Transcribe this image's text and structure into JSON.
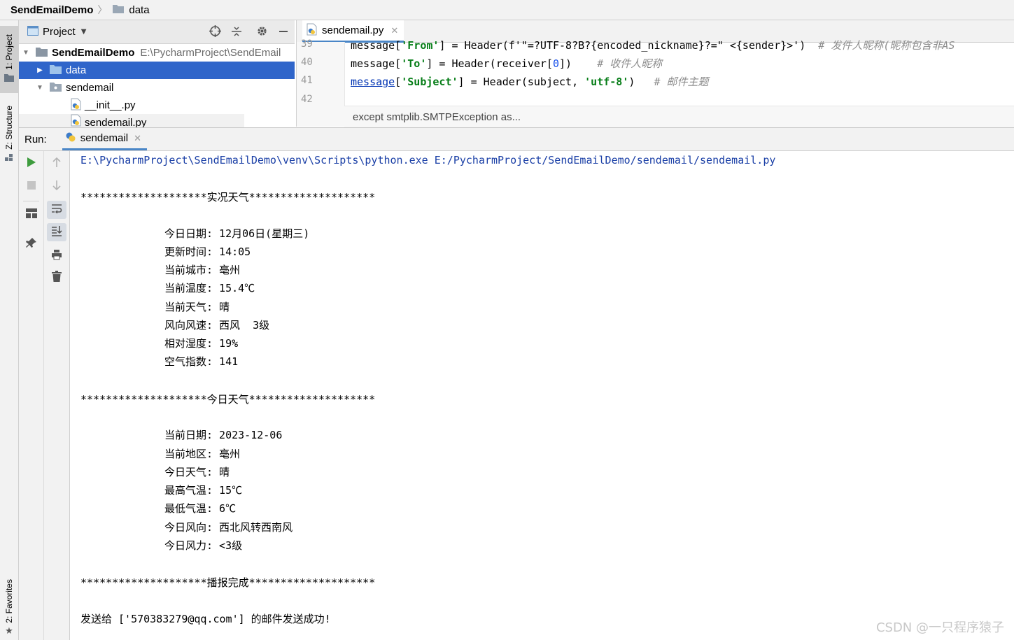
{
  "breadcrumb": {
    "project": "SendEmailDemo",
    "folder": "data"
  },
  "tool_strip": {
    "project_tab": "1: Project",
    "structure_tab": "Z: Structure",
    "favorites_tab": "2: Favorites"
  },
  "project_panel": {
    "title": "Project",
    "tree": [
      {
        "label": "SendEmailDemo",
        "path": "E:\\PycharmProject\\SendEmail"
      },
      {
        "label": "data"
      },
      {
        "label": "sendemail"
      },
      {
        "label": "__init__.py"
      },
      {
        "label": "sendemail.py"
      }
    ]
  },
  "editor": {
    "tab_label": "sendemail.py",
    "line_numbers": [
      "39",
      "40",
      "41",
      "42"
    ],
    "line39": {
      "a": "message[",
      "b": "'From'",
      "c": "] = Header(f'\"=?UTF-8?B?{encoded_nickname}?=\" <{sender}>')  ",
      "d": "# 发件人昵称(昵称包含非AS"
    },
    "line40": {
      "a": "message[",
      "b": "'To'",
      "c": "] = Header(receiver[",
      "n": "0",
      "e": "])    ",
      "d": "# 收件人昵称"
    },
    "line41": {
      "f": "message",
      "a": "[",
      "b": "'Subject'",
      "c": "] = Header(subject, ",
      "s": "'utf-8'",
      "e": ")   ",
      "d": "# 邮件主题"
    },
    "context_hint": "except smtplib.SMTPException as..."
  },
  "run": {
    "label": "Run:",
    "tab_label": "sendemail",
    "console": {
      "command": "E:\\PycharmProject\\SendEmailDemo\\venv\\Scripts\\python.exe E:/PycharmProject/SendEmailDemo/sendemail/sendemail.py",
      "header1": "********************实况天气********************",
      "live": [
        "今日日期: 12月06日(星期三)",
        "更新时间: 14:05",
        "当前城市: 亳州",
        "当前温度: 15.4℃",
        "当前天气: 晴",
        "风向风速: 西风  3级",
        "相对湿度: 19%",
        "空气指数: 141"
      ],
      "header2": "********************今日天气********************",
      "today": [
        "当前日期: 2023-12-06",
        "当前地区: 亳州",
        "今日天气: 晴",
        "最高气温: 15℃",
        "最低气温: 6℃",
        "今日风向: 西北风转西南风",
        "今日风力: <3级"
      ],
      "header3": "********************播报完成********************",
      "result": "发送给 ['570383279@qq.com'] 的邮件发送成功!"
    }
  },
  "watermark": "CSDN @一只程序猿子",
  "colors": {
    "selection": "#2f65ca",
    "run_green": "#3d9b3d",
    "folder_blue": "#6fa3d8"
  }
}
